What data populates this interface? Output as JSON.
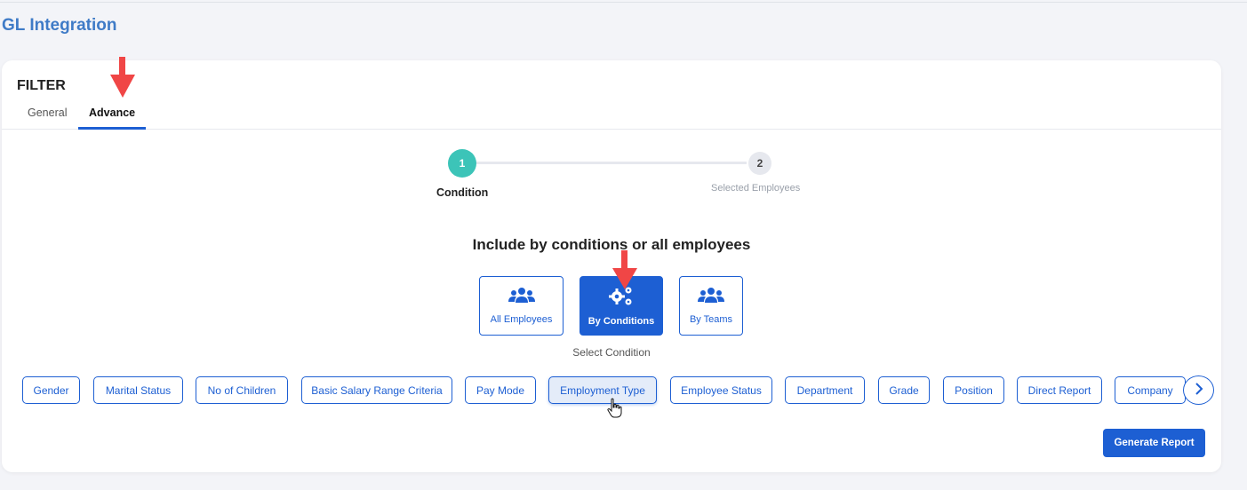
{
  "page": {
    "title": "GL Integration"
  },
  "filter": {
    "title": "FILTER",
    "tabs": [
      {
        "label": "General",
        "active": false
      },
      {
        "label": "Advance",
        "active": true
      }
    ]
  },
  "stepper": {
    "steps": [
      {
        "number": "1",
        "label": "Condition",
        "active": true
      },
      {
        "number": "2",
        "label": "Selected Employees",
        "active": false
      }
    ]
  },
  "main": {
    "heading": "Include by conditions or all employees",
    "options": [
      {
        "label": "All Employees",
        "icon": "users-icon",
        "selected": false
      },
      {
        "label": "By Conditions",
        "icon": "gears-icon",
        "selected": true
      },
      {
        "label": "By Teams",
        "icon": "users-icon",
        "selected": false
      }
    ],
    "select_condition_label": "Select Condition",
    "conditions": [
      {
        "label": "Gender"
      },
      {
        "label": "Marital Status"
      },
      {
        "label": "No of Children"
      },
      {
        "label": "Basic Salary Range Criteria"
      },
      {
        "label": "Pay Mode"
      },
      {
        "label": "Employment Type",
        "hovered": true
      },
      {
        "label": "Employee Status"
      },
      {
        "label": "Department"
      },
      {
        "label": "Grade"
      },
      {
        "label": "Position"
      },
      {
        "label": "Direct Report"
      },
      {
        "label": "Company"
      }
    ],
    "generate_button": "Generate Report"
  },
  "colors": {
    "primary": "#1d5fd3",
    "title": "#3f7bc7",
    "step_active": "#3cc4b8",
    "annotation_arrow": "#f04646"
  }
}
